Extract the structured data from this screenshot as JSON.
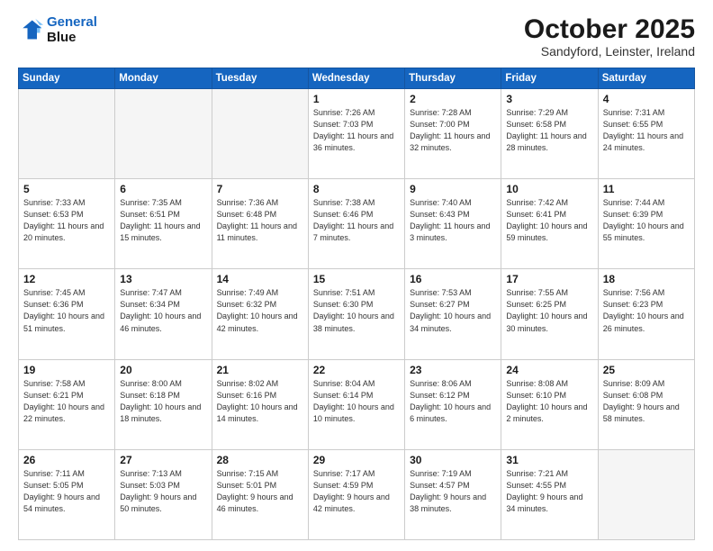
{
  "header": {
    "logo_line1": "General",
    "logo_line2": "Blue",
    "month": "October 2025",
    "location": "Sandyford, Leinster, Ireland"
  },
  "days_of_week": [
    "Sunday",
    "Monday",
    "Tuesday",
    "Wednesday",
    "Thursday",
    "Friday",
    "Saturday"
  ],
  "weeks": [
    [
      {
        "day": "",
        "empty": true
      },
      {
        "day": "",
        "empty": true
      },
      {
        "day": "",
        "empty": true
      },
      {
        "day": "1",
        "sunrise": "7:26 AM",
        "sunset": "7:03 PM",
        "daylight": "11 hours and 36 minutes."
      },
      {
        "day": "2",
        "sunrise": "7:28 AM",
        "sunset": "7:00 PM",
        "daylight": "11 hours and 32 minutes."
      },
      {
        "day": "3",
        "sunrise": "7:29 AM",
        "sunset": "6:58 PM",
        "daylight": "11 hours and 28 minutes."
      },
      {
        "day": "4",
        "sunrise": "7:31 AM",
        "sunset": "6:55 PM",
        "daylight": "11 hours and 24 minutes."
      }
    ],
    [
      {
        "day": "5",
        "sunrise": "7:33 AM",
        "sunset": "6:53 PM",
        "daylight": "11 hours and 20 minutes."
      },
      {
        "day": "6",
        "sunrise": "7:35 AM",
        "sunset": "6:51 PM",
        "daylight": "11 hours and 15 minutes."
      },
      {
        "day": "7",
        "sunrise": "7:36 AM",
        "sunset": "6:48 PM",
        "daylight": "11 hours and 11 minutes."
      },
      {
        "day": "8",
        "sunrise": "7:38 AM",
        "sunset": "6:46 PM",
        "daylight": "11 hours and 7 minutes."
      },
      {
        "day": "9",
        "sunrise": "7:40 AM",
        "sunset": "6:43 PM",
        "daylight": "11 hours and 3 minutes."
      },
      {
        "day": "10",
        "sunrise": "7:42 AM",
        "sunset": "6:41 PM",
        "daylight": "10 hours and 59 minutes."
      },
      {
        "day": "11",
        "sunrise": "7:44 AM",
        "sunset": "6:39 PM",
        "daylight": "10 hours and 55 minutes."
      }
    ],
    [
      {
        "day": "12",
        "sunrise": "7:45 AM",
        "sunset": "6:36 PM",
        "daylight": "10 hours and 51 minutes."
      },
      {
        "day": "13",
        "sunrise": "7:47 AM",
        "sunset": "6:34 PM",
        "daylight": "10 hours and 46 minutes."
      },
      {
        "day": "14",
        "sunrise": "7:49 AM",
        "sunset": "6:32 PM",
        "daylight": "10 hours and 42 minutes."
      },
      {
        "day": "15",
        "sunrise": "7:51 AM",
        "sunset": "6:30 PM",
        "daylight": "10 hours and 38 minutes."
      },
      {
        "day": "16",
        "sunrise": "7:53 AM",
        "sunset": "6:27 PM",
        "daylight": "10 hours and 34 minutes."
      },
      {
        "day": "17",
        "sunrise": "7:55 AM",
        "sunset": "6:25 PM",
        "daylight": "10 hours and 30 minutes."
      },
      {
        "day": "18",
        "sunrise": "7:56 AM",
        "sunset": "6:23 PM",
        "daylight": "10 hours and 26 minutes."
      }
    ],
    [
      {
        "day": "19",
        "sunrise": "7:58 AM",
        "sunset": "6:21 PM",
        "daylight": "10 hours and 22 minutes."
      },
      {
        "day": "20",
        "sunrise": "8:00 AM",
        "sunset": "6:18 PM",
        "daylight": "10 hours and 18 minutes."
      },
      {
        "day": "21",
        "sunrise": "8:02 AM",
        "sunset": "6:16 PM",
        "daylight": "10 hours and 14 minutes."
      },
      {
        "day": "22",
        "sunrise": "8:04 AM",
        "sunset": "6:14 PM",
        "daylight": "10 hours and 10 minutes."
      },
      {
        "day": "23",
        "sunrise": "8:06 AM",
        "sunset": "6:12 PM",
        "daylight": "10 hours and 6 minutes."
      },
      {
        "day": "24",
        "sunrise": "8:08 AM",
        "sunset": "6:10 PM",
        "daylight": "10 hours and 2 minutes."
      },
      {
        "day": "25",
        "sunrise": "8:09 AM",
        "sunset": "6:08 PM",
        "daylight": "9 hours and 58 minutes."
      }
    ],
    [
      {
        "day": "26",
        "sunrise": "7:11 AM",
        "sunset": "5:05 PM",
        "daylight": "9 hours and 54 minutes."
      },
      {
        "day": "27",
        "sunrise": "7:13 AM",
        "sunset": "5:03 PM",
        "daylight": "9 hours and 50 minutes."
      },
      {
        "day": "28",
        "sunrise": "7:15 AM",
        "sunset": "5:01 PM",
        "daylight": "9 hours and 46 minutes."
      },
      {
        "day": "29",
        "sunrise": "7:17 AM",
        "sunset": "4:59 PM",
        "daylight": "9 hours and 42 minutes."
      },
      {
        "day": "30",
        "sunrise": "7:19 AM",
        "sunset": "4:57 PM",
        "daylight": "9 hours and 38 minutes."
      },
      {
        "day": "31",
        "sunrise": "7:21 AM",
        "sunset": "4:55 PM",
        "daylight": "9 hours and 34 minutes."
      },
      {
        "day": "",
        "empty": true
      }
    ]
  ]
}
